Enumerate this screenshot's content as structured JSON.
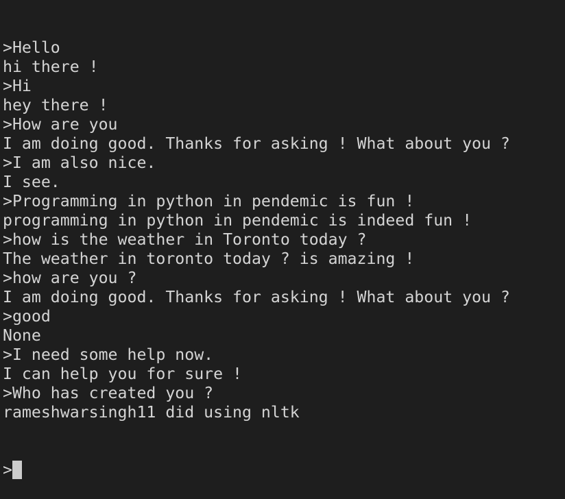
{
  "terminal": {
    "lines": [
      ">Hello",
      "hi there !",
      ">Hi",
      "hey there !",
      ">How are you",
      "I am doing good. Thanks for asking ! What about you ?",
      ">I am also nice.",
      "I see.",
      ">Programming in python in pendemic is fun !",
      "programming in python in pendemic is indeed fun !",
      ">how is the weather in Toronto today ?",
      "The weather in toronto today ? is amazing !",
      ">how are you ?",
      "I am doing good. Thanks for asking ! What about you ?",
      ">good",
      "None",
      ">I need some help now.",
      "I can help you for sure !",
      ">Who has created you ?",
      "rameshwarsingh11 did using nltk"
    ],
    "prompt": ">",
    "colors": {
      "background": "#1e1e1e",
      "text": "#d4d4d4",
      "cursor": "#cccccc"
    }
  }
}
